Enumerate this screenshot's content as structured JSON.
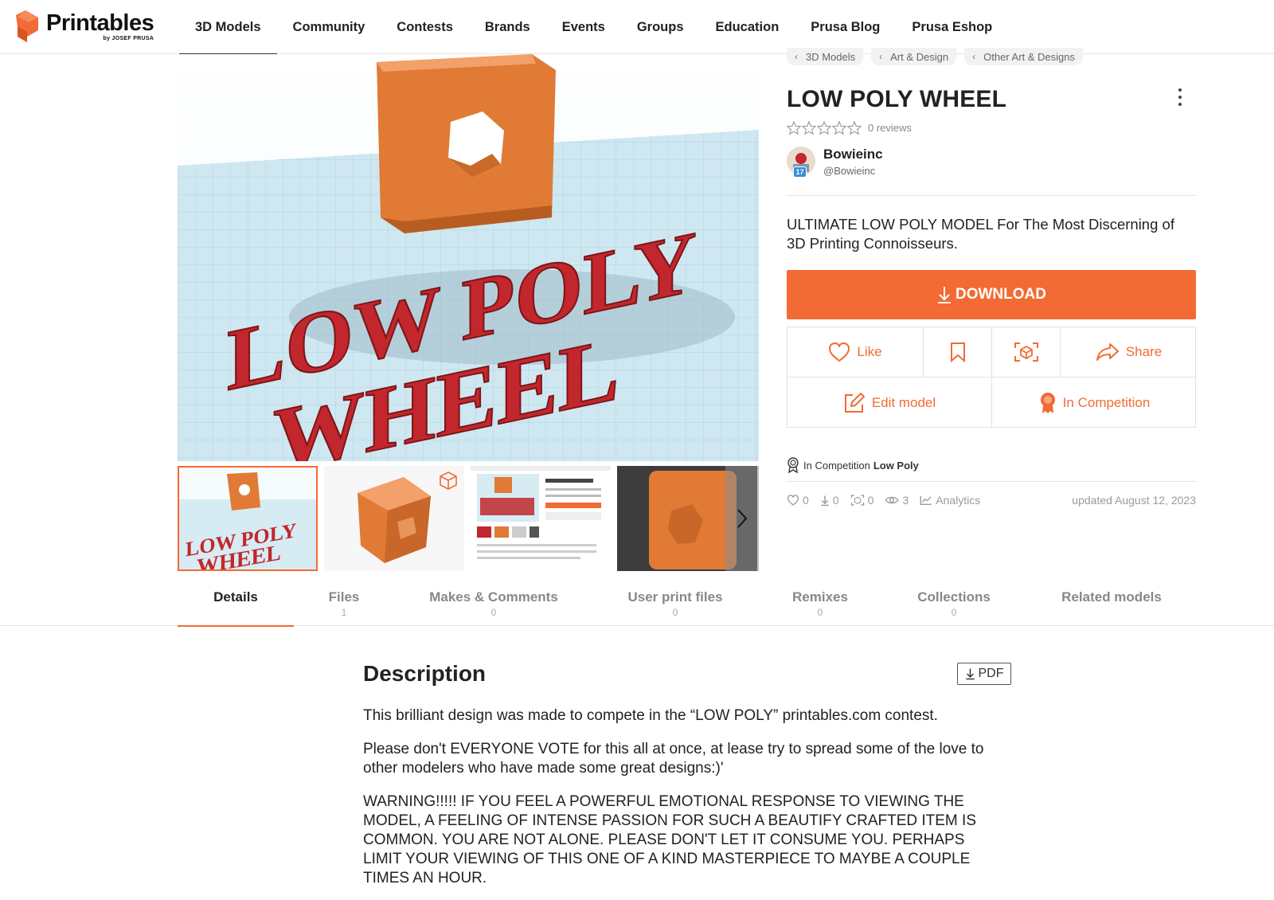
{
  "brand": {
    "name": "Printables",
    "sub": "by JOSEF PRUSA",
    "accent": "#f26b34"
  },
  "nav": [
    "3D Models",
    "Community",
    "Contests",
    "Brands",
    "Events",
    "Groups",
    "Education",
    "Prusa Blog",
    "Prusa Eshop"
  ],
  "hero": {
    "render_text_line1": "LOW POLY",
    "render_text_line2": "WHEEL",
    "thumb_text_line1": "LOW POLY",
    "thumb_text_line2": "WHEEL"
  },
  "breadcrumbs": [
    "3D Models",
    "Art & Design",
    "Other Art & Designs"
  ],
  "model": {
    "title": "LOW POLY WHEEL",
    "reviews": "0 reviews",
    "rating": 0,
    "author_name": "Bowieinc",
    "author_handle": "@Bowieinc",
    "author_level": "17",
    "summary": "ULTIMATE LOW POLY MODEL For The Most Discerning of 3D Printing Connoisseurs."
  },
  "actions": {
    "download": "DOWNLOAD",
    "like": "Like",
    "share": "Share",
    "edit": "Edit model",
    "competition": "In Competition"
  },
  "competition": {
    "prefix": "In Competition",
    "name": "Low Poly"
  },
  "stats": {
    "likes": "0",
    "downloads": "0",
    "makes": "0",
    "views": "3",
    "analytics": "Analytics",
    "updated": "updated August 12, 2023"
  },
  "tabs": [
    {
      "label": "Details",
      "count": ""
    },
    {
      "label": "Files",
      "count": "1"
    },
    {
      "label": "Makes & Comments",
      "count": "0"
    },
    {
      "label": "User print files",
      "count": "0"
    },
    {
      "label": "Remixes",
      "count": "0"
    },
    {
      "label": "Collections",
      "count": "0"
    },
    {
      "label": "Related models",
      "count": ""
    }
  ],
  "description": {
    "title": "Description",
    "pdf": "PDF",
    "p1": "This brilliant design was made to compete in the “LOW POLY” printables.com contest.",
    "p2": "Please don't EVERYONE VOTE for this all at once, at lease try to spread some of the love to other modelers who have made some great designs:)'",
    "p3": "WARNING!!!!! IF YOU FEEL A POWERFUL EMOTIONAL RESPONSE TO VIEWING THE MODEL, A FEELING OF INTENSE PASSION FOR SUCH A BEAUTIFY CRAFTED ITEM IS COMMON. YOU ARE NOT ALONE. PLEASE DON'T LET IT CONSUME YOU. PERHAPS LIMIT YOUR VIEWING OF THIS ONE OF A KIND MASTERPIECE TO MAYBE A COUPLE TIMES AN HOUR."
  }
}
